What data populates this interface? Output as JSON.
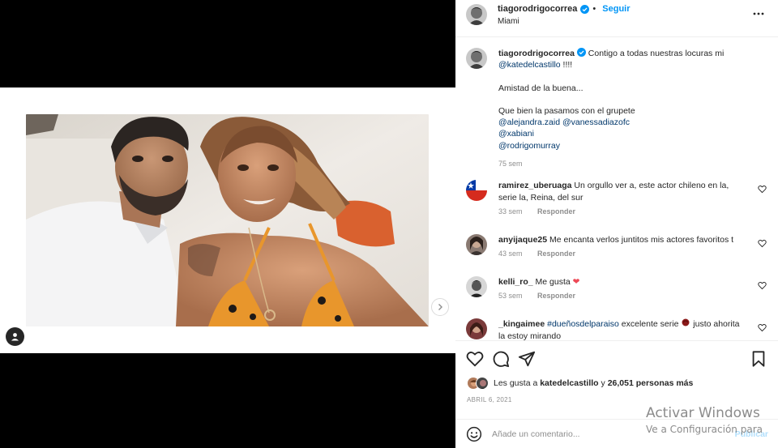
{
  "post": {
    "username": "tiagorodrigocorrea",
    "location": "Miami",
    "follow_label": "Seguir",
    "dot": "•",
    "more_icon": "more-horizontal-icon"
  },
  "caption": {
    "username": "tiagorodrigocorrea",
    "text_start": "Contigo a todas nuestras locuras mi",
    "mention_main": "@katedelcastillo",
    "text_end": " !!!!",
    "line2": "Amistad de la buena...",
    "line3": "Que bien la pasamos con el grupete",
    "mentions": [
      "@alejandra.zaid",
      "@vanessadiazofc",
      "@xabiani",
      "@rodrigomurray"
    ],
    "time": "75 sem"
  },
  "comments": [
    {
      "username": "ramirez_uberuaga",
      "text": "Un orgullo ver a, este actor chileno en la, serie la, Reina, del sur",
      "time": "33 sem",
      "reply": "Responder"
    },
    {
      "username": "anyijaque25",
      "text": "Me encanta verlos juntitos mis actores favoritos t",
      "time": "43 sem",
      "reply": "Responder"
    },
    {
      "username": "kelli_ro_",
      "text": "Me gusta ",
      "emoji": "❤",
      "time": "53 sem",
      "reply": "Responder"
    },
    {
      "username": "_kingaimee",
      "hashtag": "#dueñosdelparaiso",
      "text": " excelente serie",
      "text_after": " justo ahorita",
      "text_line2": "la estoy mirando"
    }
  ],
  "likes": {
    "prefix": "Les gusta a ",
    "user": "katedelcastillo",
    "middle": " y ",
    "count": "26,051 personas más"
  },
  "date": "ABRIL 6, 2021",
  "add_comment": {
    "placeholder": "Añade un comentario...",
    "post_label": "Publicar"
  },
  "watermark": {
    "title": "Activar Windows",
    "subtitle": "Ve a Configuración para"
  },
  "colors": {
    "link": "#00376b",
    "follow": "#0095f6",
    "heart_red": "#ed4956"
  }
}
